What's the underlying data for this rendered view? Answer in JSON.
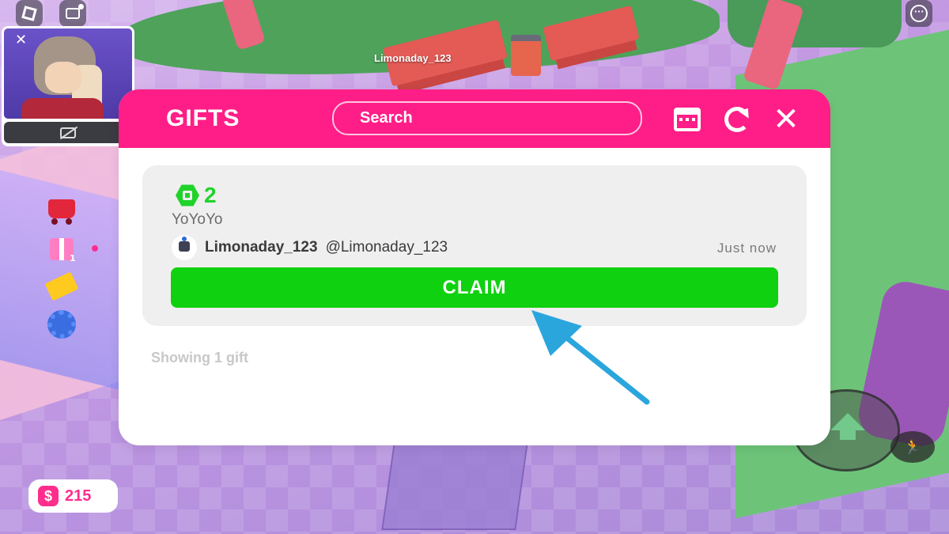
{
  "world": {
    "player_name_tag": "Limonaday_123"
  },
  "hud": {
    "roblox_menu_icon": "roblox-logo-icon",
    "chat_icon": "chat-icon",
    "more_icon": "more-options-icon",
    "more_glyph": "···",
    "camera_close_glyph": "✕"
  },
  "side_menu": {
    "items": [
      {
        "icon": "shop-cart-icon"
      },
      {
        "icon": "gift-icon",
        "badge": "1"
      },
      {
        "icon": "ticket-icon"
      },
      {
        "icon": "settings-gear-icon"
      }
    ]
  },
  "currency": {
    "symbol": "$",
    "amount": "215"
  },
  "gifts_modal": {
    "title": "GIFTS",
    "search_placeholder": "Search",
    "close_glyph": "✕",
    "gifts": [
      {
        "robux_amount": "2",
        "message": "YoYoYo",
        "sender_display_name": "Limonaday_123",
        "sender_username": "@Limonaday_123",
        "time": "Just now",
        "claim_label": "CLAIM"
      }
    ],
    "footer": "Showing 1 gift"
  },
  "colors": {
    "header_pink": "#ff1e87",
    "claim_green": "#0fd10f",
    "robux_green": "#1fd32a",
    "pointer_blue": "#2ba6dd"
  }
}
